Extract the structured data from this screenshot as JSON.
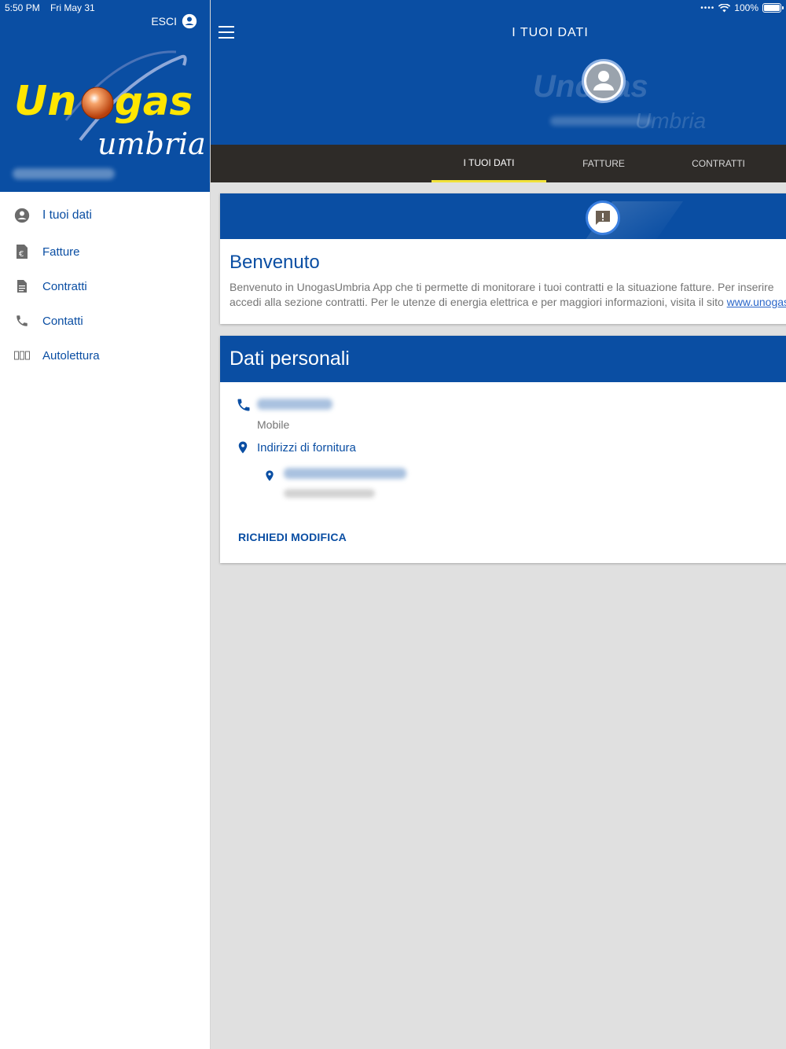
{
  "status_bar": {
    "time": "5:50 PM",
    "date": "Fri May 31",
    "battery": "100%"
  },
  "sidebar": {
    "logout_label": "ESCI",
    "logo": {
      "brand": "Unogas",
      "sub": "Umbria"
    },
    "items": [
      {
        "label": "I tuoi dati",
        "icon": "account-circle-icon",
        "active": true
      },
      {
        "label": "Fatture",
        "icon": "invoice-icon"
      },
      {
        "label": "Contratti",
        "icon": "contract-icon"
      },
      {
        "label": "Contatti",
        "icon": "phone-icon"
      },
      {
        "label": "Autolettura",
        "icon": "meter-icon"
      }
    ]
  },
  "header": {
    "title": "I TUOI DATI"
  },
  "tabs": [
    {
      "label": "I TUOI DATI",
      "active": true
    },
    {
      "label": "FATTURE"
    },
    {
      "label": "CONTRATTI"
    }
  ],
  "welcome": {
    "title": "Benvenuto",
    "line1": "Benvenuto in UnogasUmbria App che ti permette di monitorare i tuoi contratti e la situazione fatture. Per inserire",
    "line2": "accedi alla sezione contratti. Per le utenze di energia elettrica e per maggiori informazioni, visita il sito ",
    "link": "www.unogas"
  },
  "personal_data": {
    "title": "Dati personali",
    "phone_type": "Mobile",
    "addresses_title": "Indirizzi di fornitura",
    "edit_label": "RICHIEDI MODIFICA"
  },
  "colors": {
    "primary": "#0a4ea3",
    "tab_bar": "#2e2b28",
    "tab_indicator": "#f1e23a",
    "logo_yellow": "#ffe600"
  }
}
